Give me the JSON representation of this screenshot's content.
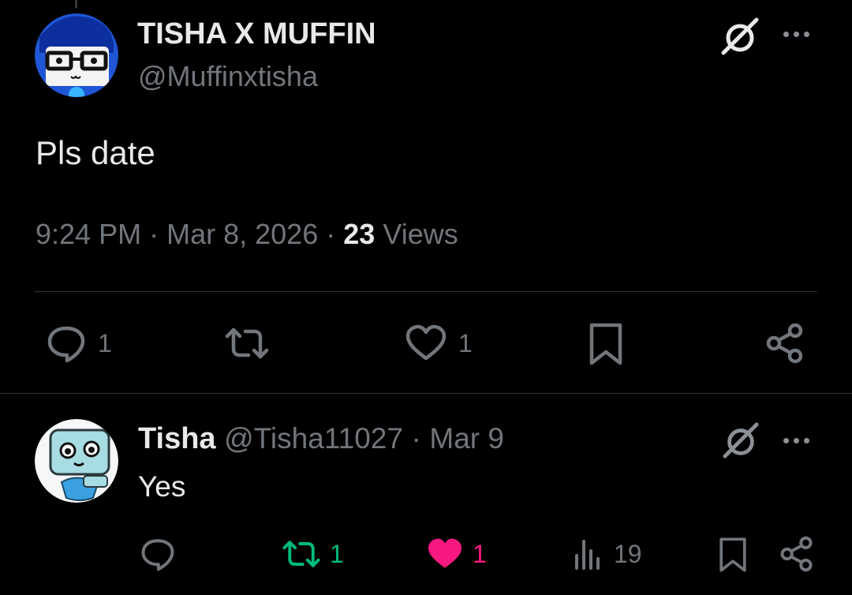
{
  "main_post": {
    "display_name": "TISHA X MUFFIN",
    "handle": "@Muffinxtisha",
    "text": "Pls date",
    "time": "9:24 PM",
    "date": "Mar 8, 2026",
    "views_count": "23",
    "views_label": "Views",
    "separator": "·",
    "replies": "1",
    "likes": "1"
  },
  "reply": {
    "display_name": "Tisha",
    "handle": "@Tisha11027",
    "date": "Mar 9",
    "separator": "·",
    "text": "Yes",
    "reposts": "1",
    "likes": "1",
    "views": "19"
  },
  "colors": {
    "background": "#000000",
    "text": "#e7e9ea",
    "muted": "#71767b",
    "repost_green": "#00ba7c",
    "like_pink": "#f91880",
    "divider": "#2f3336"
  },
  "icons": [
    "grok-icon",
    "more-icon",
    "reply-icon",
    "repost-icon",
    "like-icon",
    "bookmark-icon",
    "share-icon",
    "views-icon"
  ]
}
